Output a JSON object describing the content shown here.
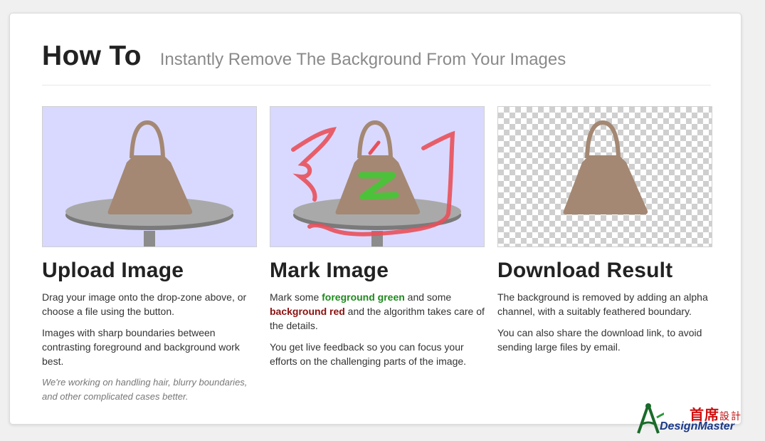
{
  "header": {
    "title": "How To",
    "subtitle": "Instantly Remove The Background From Your Images"
  },
  "steps": [
    {
      "heading": "Upload Image",
      "paragraphs": [
        "Drag your image onto the drop-zone above, or choose a file using the button.",
        "Images with sharp boundaries between contrasting foreground and background work best."
      ],
      "note": "We're working on handling hair, blurry boundaries, and other complicated cases better."
    },
    {
      "heading": "Mark Image",
      "p1_before": "Mark some ",
      "p1_fg": "foreground green",
      "p1_mid": " and some ",
      "p1_bg": "background red",
      "p1_after": " and the algorithm takes care of the details.",
      "p2": "You get live feedback so you can focus your efforts on the challenging parts of the image."
    },
    {
      "heading": "Download Result",
      "paragraphs": [
        "The background is removed by adding an alpha channel, with a suitably feathered boundary.",
        "You can also share the download link, to avoid sending large files by email."
      ]
    }
  ],
  "watermark": {
    "chinese_title": "首席",
    "chinese_suffix": "設計",
    "english": "DesignMaster"
  },
  "colors": {
    "bag": "#a48873",
    "table": "#a9a9a9",
    "lavender": "#d9d9ff",
    "foreground_mark": "#4cc23a",
    "background_mark": "#e8505a"
  }
}
